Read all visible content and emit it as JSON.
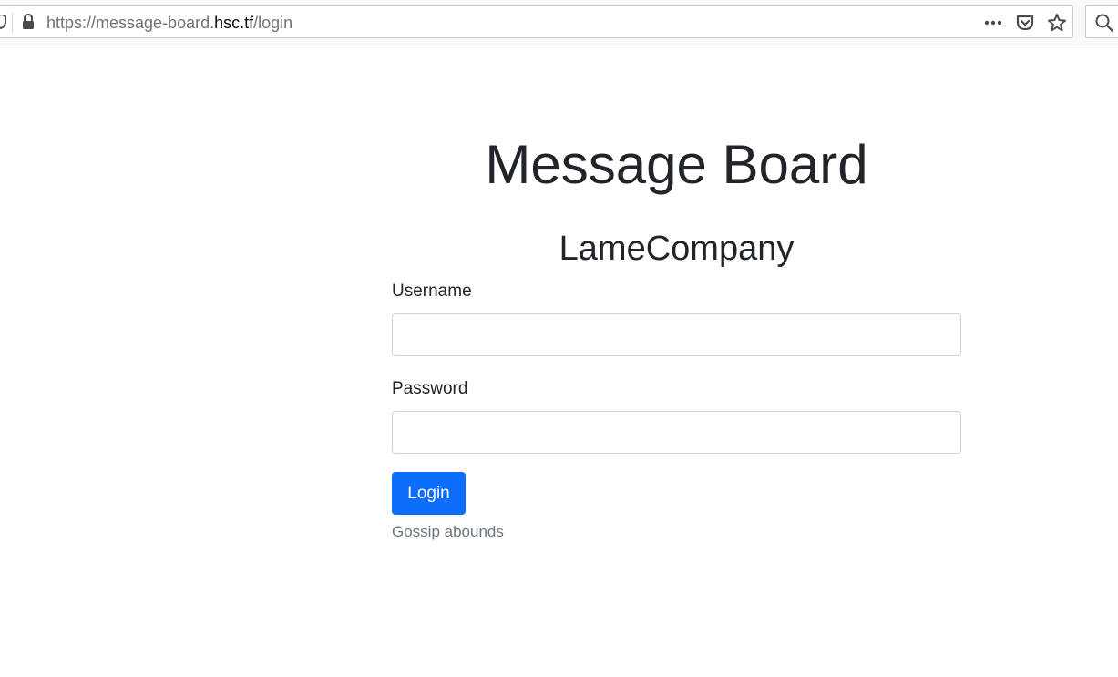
{
  "browser": {
    "url_prefix": "https://message-board.",
    "url_domain": "hsc.tf",
    "url_path": "/login"
  },
  "page": {
    "title": "Message Board",
    "subtitle": "LameCompany",
    "username_label": "Username",
    "password_label": "Password",
    "username_value": "",
    "password_value": "",
    "login_button": "Login",
    "hint": "Gossip abounds"
  },
  "colors": {
    "primary": "#0d6efd",
    "text": "#212529",
    "muted": "#6c757d"
  },
  "icons": [
    "shield-icon",
    "lock-icon",
    "more-icon",
    "pocket-icon",
    "star-icon",
    "search-icon"
  ]
}
